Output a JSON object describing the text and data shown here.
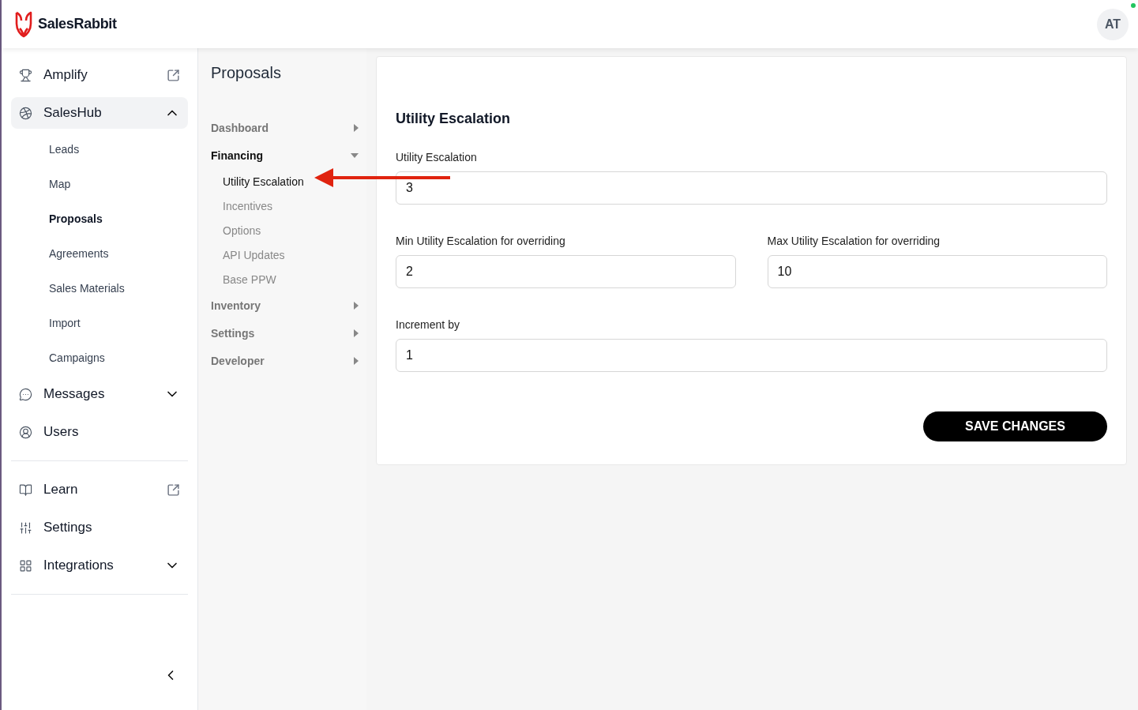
{
  "app": {
    "name": "SalesRabbit"
  },
  "user": {
    "initials": "AT",
    "online": true
  },
  "sidebar": {
    "sections": [
      [
        {
          "label": "Amplify",
          "kind": "external"
        },
        {
          "label": "SalesHub",
          "kind": "expandable",
          "expanded": true,
          "children": [
            {
              "label": "Leads",
              "selected": false
            },
            {
              "label": "Map",
              "selected": false
            },
            {
              "label": "Proposals",
              "selected": true
            },
            {
              "label": "Agreements",
              "selected": false
            },
            {
              "label": "Sales Materials",
              "selected": false
            },
            {
              "label": "Import",
              "selected": false
            },
            {
              "label": "Campaigns",
              "selected": false
            }
          ]
        },
        {
          "label": "Messages",
          "kind": "expandable",
          "expanded": false
        },
        {
          "label": "Users",
          "kind": "plain"
        }
      ],
      [
        {
          "label": "Learn",
          "kind": "external"
        },
        {
          "label": "Settings",
          "kind": "plain"
        },
        {
          "label": "Integrations",
          "kind": "expandable",
          "expanded": false
        }
      ]
    ]
  },
  "subnav": {
    "title": "Proposals",
    "items": [
      {
        "label": "Dashboard",
        "expanded": false,
        "selected": false
      },
      {
        "label": "Financing",
        "expanded": true,
        "selected": true,
        "children": [
          {
            "label": "Utility Escalation",
            "selected": true
          },
          {
            "label": "Incentives",
            "selected": false
          },
          {
            "label": "Options",
            "selected": false
          },
          {
            "label": "API Updates",
            "selected": false
          },
          {
            "label": "Base PPW",
            "selected": false
          }
        ]
      },
      {
        "label": "Inventory",
        "expanded": false,
        "selected": false
      },
      {
        "label": "Settings",
        "expanded": false,
        "selected": false
      },
      {
        "label": "Developer",
        "expanded": false,
        "selected": false
      }
    ]
  },
  "form": {
    "title": "Utility Escalation",
    "rows": [
      [
        {
          "label": "Utility Escalation",
          "value": "3"
        }
      ],
      [
        {
          "label": "Min Utility Escalation for overriding",
          "value": "2"
        },
        {
          "label": "Max Utility Escalation for overriding",
          "value": "10"
        }
      ],
      [
        {
          "label": "Increment by",
          "value": "1"
        }
      ]
    ],
    "button": "SAVE CHANGES"
  }
}
